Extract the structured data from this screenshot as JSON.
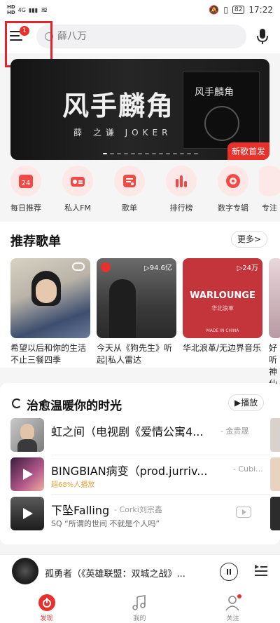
{
  "status": {
    "network": "4G",
    "battery": "82",
    "time": "17:22"
  },
  "header": {
    "menu_badge": "1",
    "search_placeholder": "薛八万"
  },
  "banner": {
    "title": "风手麟角",
    "subtitle": "薛 之谦  JOKER",
    "badge": "新歌首发"
  },
  "quick_entries": [
    {
      "label": "每日推荐",
      "icon": "calendar-icon",
      "icon_text": "24"
    },
    {
      "label": "私人FM",
      "icon": "radio-icon"
    },
    {
      "label": "歌单",
      "icon": "playlist-icon"
    },
    {
      "label": "排行榜",
      "icon": "chart-icon"
    },
    {
      "label": "数字专辑",
      "icon": "album-icon"
    },
    {
      "label": "专注",
      "icon": "focus-icon"
    }
  ],
  "playlists": {
    "title": "推荐歌单",
    "more": "更多>",
    "items": [
      {
        "caption": "希望以后和你的生活不止三餐四季",
        "count": ""
      },
      {
        "caption": "今天从《狗先生》听起|私人雷达",
        "count": "▷94.6亿"
      },
      {
        "caption": "华北浪革/无边界音乐",
        "count": "▷24万",
        "cover_text": "WARLOUNGE",
        "cover_sub": "华北浪革",
        "cover_foot": "MADE IN CHINA"
      },
      {
        "caption": "好听神仙",
        "count": ""
      }
    ]
  },
  "healing": {
    "title": "治愈温暖你的时光",
    "play": "▶播放",
    "songs": [
      {
        "title": "虹之间（电视剧《爱情公寓4...",
        "artist": "- 金贵晟",
        "sub": ""
      },
      {
        "title": "BINGBIAN病变（prod.jurriv...",
        "artist": "- Cubi...",
        "sub": "超68%人播放"
      },
      {
        "title": "下坠Falling",
        "artist": "- Corki刘宗鑫",
        "sub": "SQ “所谓的世间 不就是个人吗”"
      }
    ]
  },
  "player": {
    "now_playing": "孤勇者（《英雄联盟：双城之战》..."
  },
  "nav": [
    {
      "label": "发现",
      "icon": "discover-icon"
    },
    {
      "label": "我的",
      "icon": "music-note-icon"
    },
    {
      "label": "关注",
      "icon": "follow-icon"
    }
  ],
  "colors": {
    "accent": "#e9302a"
  }
}
